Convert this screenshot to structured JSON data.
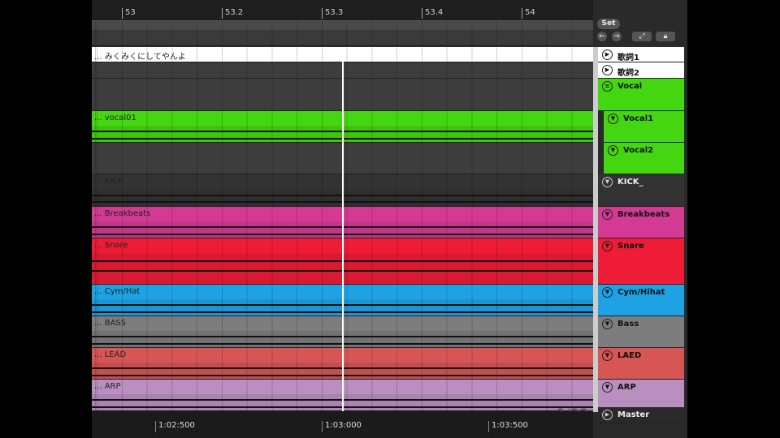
{
  "ruler": {
    "ticks": [
      "53",
      "53.2",
      "53.3",
      "53.4",
      "54"
    ]
  },
  "controls": {
    "set_label": "Set",
    "left_arrow": "←",
    "right_arrow": "→",
    "page_count": "1/32"
  },
  "tracks": [
    {
      "clip": "... みくみくにしてやんよ",
      "name": "歌詞1",
      "color": "#ffffff",
      "icon": "play-icon"
    },
    {
      "clip": "",
      "name": "歌詞2",
      "color": "#ffffff",
      "icon": "play-icon"
    },
    {
      "clip": "",
      "name": "Vocal",
      "color": "#44d610",
      "icon": "group-icon"
    },
    {
      "clip": "... vocal01",
      "name": "Vocal1",
      "color": "#44d610",
      "icon": "fold-icon"
    },
    {
      "clip": "",
      "name": "Vocal2",
      "color": "#44d610",
      "icon": "fold-icon"
    },
    {
      "clip": "... KICK",
      "name": "KICK_",
      "color": "#333333",
      "icon": "fold-icon"
    },
    {
      "clip": "... Breakbeats",
      "name": "Breakbeats",
      "color": "#d43a94",
      "icon": "fold-icon"
    },
    {
      "clip": "... Snare",
      "name": "Snare",
      "color": "#ee1c36",
      "icon": "fold-icon"
    },
    {
      "clip": "... Cym/Hat",
      "name": "Cym/Hihat",
      "color": "#1fa2e4",
      "icon": "fold-icon"
    },
    {
      "clip": "... BASS",
      "name": "Bass",
      "color": "#7d7d7d",
      "icon": "fold-icon"
    },
    {
      "clip": "... LEAD",
      "name": "LAED",
      "color": "#d65555",
      "icon": "fold-icon"
    },
    {
      "clip": "... ARP",
      "name": "ARP",
      "color": "#b98fbf",
      "icon": "fold-icon"
    }
  ],
  "master": {
    "name": "Master"
  },
  "timeline": {
    "ticks": [
      "1:02:500",
      "1:03:000",
      "1:03:500"
    ]
  }
}
